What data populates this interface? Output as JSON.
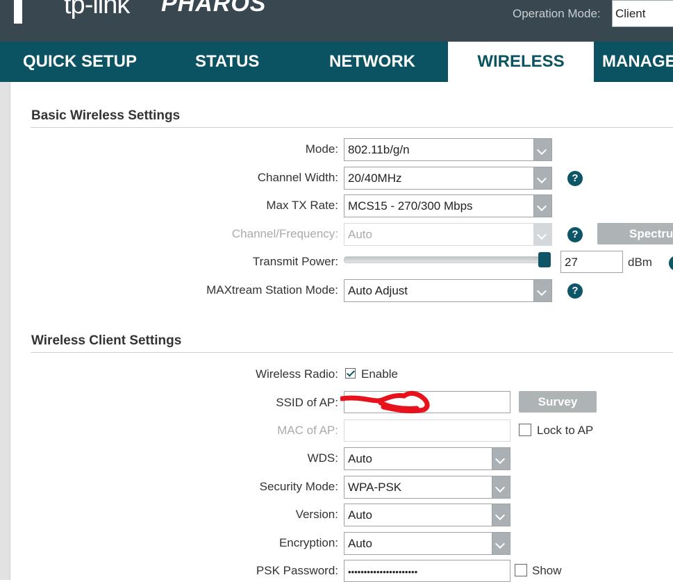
{
  "header": {
    "logo_text": "tp-link",
    "product": "PHAROS",
    "operation_mode_label": "Operation Mode:",
    "operation_mode_value": "Client"
  },
  "nav": {
    "tabs": [
      {
        "label": "QUICK SETUP",
        "active": false
      },
      {
        "label": "STATUS",
        "active": false
      },
      {
        "label": "NETWORK",
        "active": false
      },
      {
        "label": "WIRELESS",
        "active": true
      },
      {
        "label": "MANAGEMENT",
        "active": false
      }
    ]
  },
  "basic": {
    "title": "Basic Wireless Settings",
    "mode_label": "Mode:",
    "mode_value": "802.11b/g/n",
    "channel_width_label": "Channel Width:",
    "channel_width_value": "20/40MHz",
    "max_tx_label": "Max TX Rate:",
    "max_tx_value": "MCS15 - 270/300 Mbps",
    "channel_label": "Channel/Frequency:",
    "channel_value": "Auto",
    "spectrum_button": "Spectrum",
    "transmit_label": "Transmit Power:",
    "transmit_value": "27",
    "transmit_unit": "dBm",
    "maxtream_label": "MAXtream Station Mode:",
    "maxtream_value": "Auto Adjust"
  },
  "client": {
    "title": "Wireless Client Settings",
    "radio_label": "Wireless Radio:",
    "radio_checked": true,
    "radio_option": "Enable",
    "ssid_label": "SSID of AP:",
    "ssid_value": "",
    "survey_button": "Survey",
    "mac_label": "MAC of AP:",
    "mac_value": "",
    "lock_label": "Lock to AP",
    "wds_label": "WDS:",
    "wds_value": "Auto",
    "security_label": "Security Mode:",
    "security_value": "WPA-PSK",
    "version_label": "Version:",
    "version_value": "Auto",
    "encryption_label": "Encryption:",
    "encryption_value": "Auto",
    "psk_label": "PSK Password:",
    "psk_value": "••••••••••••••••••••••",
    "show_label": "Show"
  },
  "colors": {
    "header_bg": "#384750",
    "nav_bg": "#0b5363",
    "accent": "#0e5667",
    "button": "#aeb3b6"
  }
}
